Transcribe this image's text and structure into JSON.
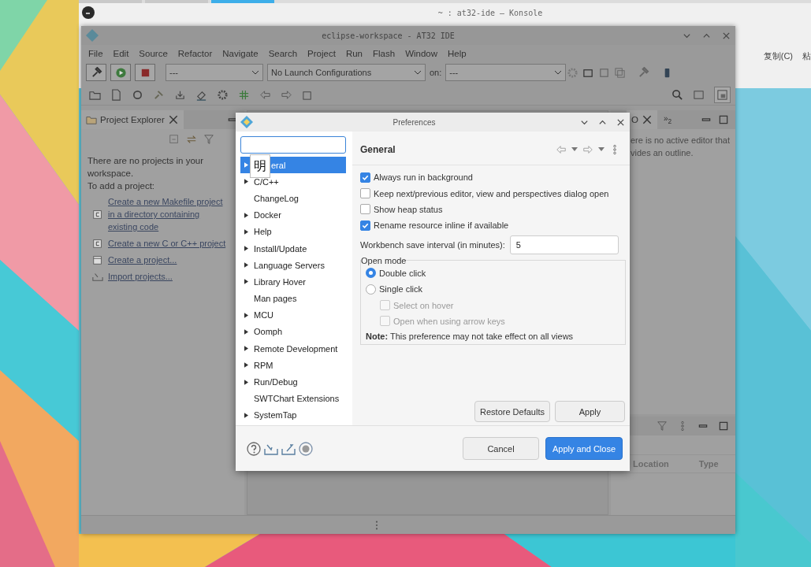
{
  "konsole": {
    "title": "~ : at32-ide — Konsole",
    "toolbar": [
      "复制(C)",
      "粘"
    ]
  },
  "ide": {
    "title": "eclipse-workspace - AT32 IDE",
    "menu": [
      "File",
      "Edit",
      "Source",
      "Refactor",
      "Navigate",
      "Search",
      "Project",
      "Run",
      "Flash",
      "Window",
      "Help"
    ],
    "build_config": "---",
    "launch_config": "No Launch Configurations",
    "on_label": "on:",
    "target": "---",
    "project_explorer": {
      "tab": "Project Explorer",
      "message": [
        "There are no projects in your workspace.",
        "To add a project:"
      ],
      "links": [
        {
          "kind": "makefile",
          "text": "Create a new Makefile project in a directory containing existing code"
        },
        {
          "kind": "cproject",
          "text": "Create a new C or C++ project"
        },
        {
          "kind": "project",
          "text": "Create a project..."
        },
        {
          "kind": "import",
          "text": "Import projects..."
        }
      ]
    },
    "outline": {
      "tab": "O",
      "overflow": "»$_{2}$",
      "message": [
        "ere is no active editor that",
        "vides an outline."
      ]
    },
    "bottom_panel": {
      "columns": [
        "Location",
        "Type"
      ]
    }
  },
  "dialog": {
    "title": "Preferences",
    "ime_candidate": "明",
    "tree": [
      {
        "label": "eral",
        "expandable": true,
        "selected": true
      },
      {
        "label": "C/C++",
        "expandable": true,
        "selected": false
      },
      {
        "label": "ChangeLog",
        "expandable": false,
        "selected": false
      },
      {
        "label": "Docker",
        "expandable": true,
        "selected": false
      },
      {
        "label": "Help",
        "expandable": true,
        "selected": false
      },
      {
        "label": "Install/Update",
        "expandable": true,
        "selected": false
      },
      {
        "label": "Language Servers",
        "expandable": true,
        "selected": false
      },
      {
        "label": "Library Hover",
        "expandable": true,
        "selected": false
      },
      {
        "label": "Man pages",
        "expandable": false,
        "selected": false
      },
      {
        "label": "MCU",
        "expandable": true,
        "selected": false
      },
      {
        "label": "Oomph",
        "expandable": true,
        "selected": false
      },
      {
        "label": "Remote Development",
        "expandable": true,
        "selected": false
      },
      {
        "label": "RPM",
        "expandable": true,
        "selected": false
      },
      {
        "label": "Run/Debug",
        "expandable": true,
        "selected": false
      },
      {
        "label": "SWTChart Extensions",
        "expandable": false,
        "selected": false
      },
      {
        "label": "SystemTap",
        "expandable": true,
        "selected": false
      }
    ],
    "heading": "General",
    "options": [
      {
        "label": "Always run in background",
        "checked": true
      },
      {
        "label": "Keep next/previous editor, view and perspectives dialog open",
        "checked": false
      },
      {
        "label": "Show heap status",
        "checked": false
      },
      {
        "label": "Rename resource inline if available",
        "checked": true
      }
    ],
    "interval": {
      "label": "Workbench save interval (in minutes):",
      "value": "5"
    },
    "open_mode": {
      "legend": "Open mode",
      "radios": [
        {
          "label": "Double click",
          "selected": true
        },
        {
          "label": "Single click",
          "selected": false
        }
      ],
      "sub_options": [
        {
          "label": "Select on hover",
          "checked": false,
          "disabled": true
        },
        {
          "label": "Open when using arrow keys",
          "checked": false,
          "disabled": true
        }
      ],
      "note": "**Note:**  This preference may not take effect on all views"
    },
    "page_buttons": [
      "Restore Defaults",
      "Apply"
    ],
    "cancel": "Cancel",
    "confirm": "Apply and Close"
  }
}
